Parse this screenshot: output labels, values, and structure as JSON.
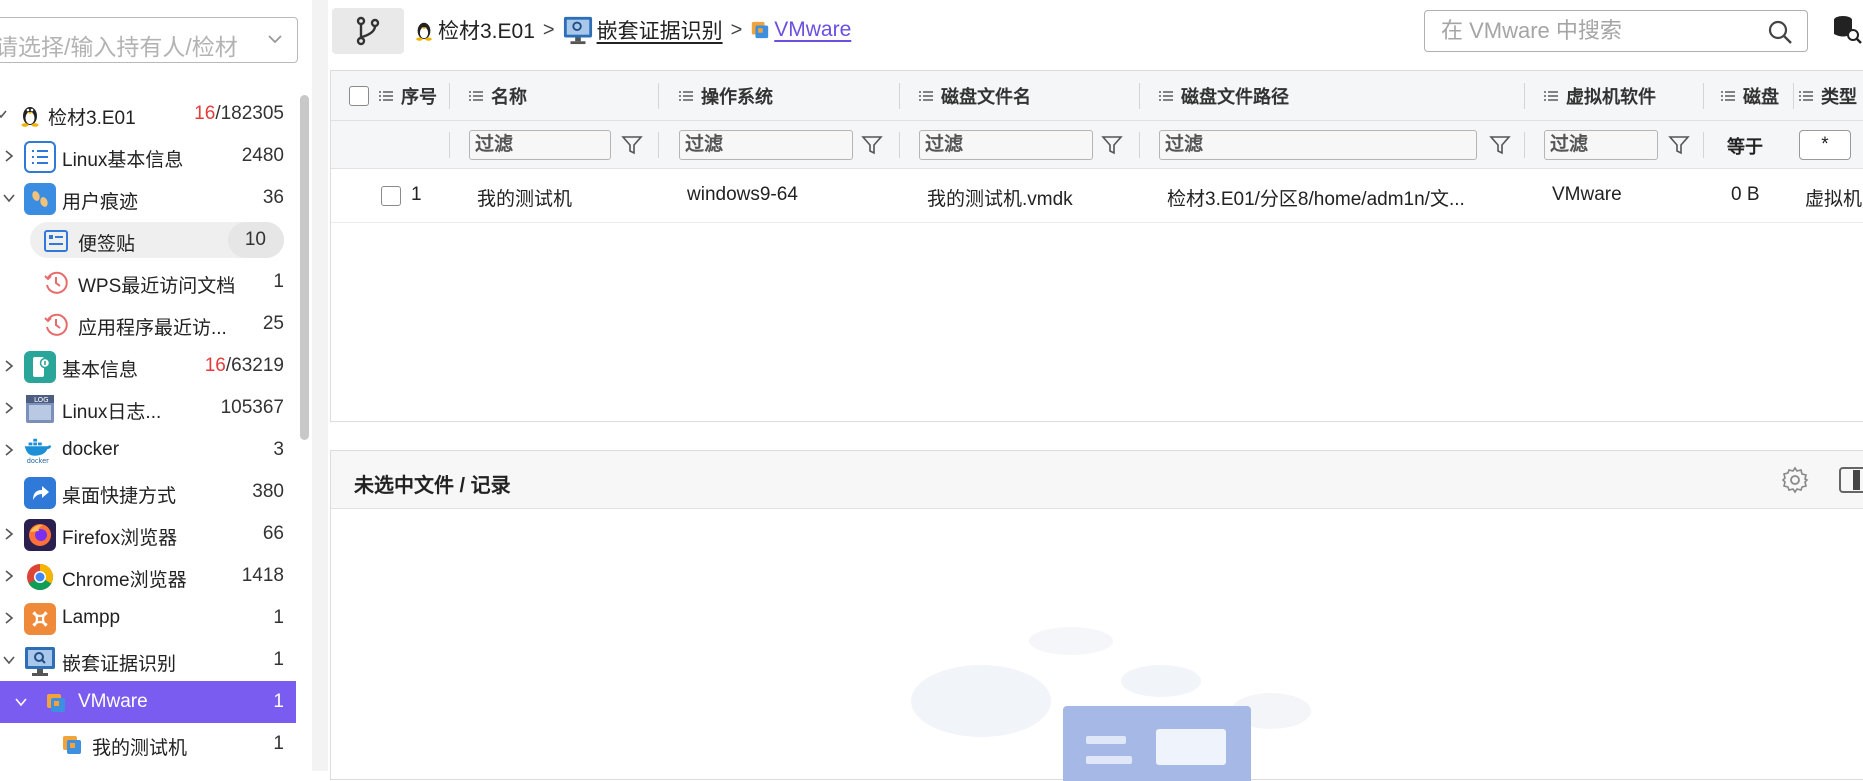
{
  "sidebar": {
    "holder_select_placeholder": "请选择/输入持有人/检材",
    "items": [
      {
        "label": "检材3.E01",
        "count_red": "16",
        "count_rest": "/182305"
      },
      {
        "label": "Linux基本信息",
        "count": "2480"
      },
      {
        "label": "用户痕迹",
        "count": "36"
      },
      {
        "label": "便签贴",
        "count": "10"
      },
      {
        "label": "WPS最近访问文档",
        "count": "1"
      },
      {
        "label": "应用程序最近访...",
        "count": "25"
      },
      {
        "label": "基本信息",
        "count_red": "16",
        "count_rest": "/63219"
      },
      {
        "label": "Linux日志...",
        "count": "105367"
      },
      {
        "label": "docker",
        "count": "3"
      },
      {
        "label": "桌面快捷方式",
        "count": "380"
      },
      {
        "label": "Firefox浏览器",
        "count": "66"
      },
      {
        "label": "Chrome浏览器",
        "count": "1418"
      },
      {
        "label": "Lampp",
        "count": "1"
      },
      {
        "label": "嵌套证据识别",
        "count": "1"
      },
      {
        "label": "VMware",
        "count": "1"
      },
      {
        "label": "我的测试机",
        "count": "1"
      }
    ]
  },
  "breadcrumb": {
    "items": [
      "检材3.E01",
      "嵌套证据识别",
      "VMware"
    ],
    "separator": ">"
  },
  "search": {
    "placeholder": "在 VMware 中搜索"
  },
  "table": {
    "columns": [
      "序号",
      "名称",
      "操作系统",
      "磁盘文件名",
      "磁盘文件路径",
      "虚拟机软件",
      "磁盘",
      "类型"
    ],
    "filter_placeholder": "过滤",
    "size_filter_op": "等于",
    "type_filter_value": "*",
    "rows": [
      {
        "index": "1",
        "name": "我的测试机",
        "os": "windows9-64",
        "disk_file": "我的测试机.vmdk",
        "disk_path": "检材3.E01/分区8/home/adm1n/文...",
        "software": "VMware",
        "size": "0 B",
        "type": "虚拟机"
      }
    ]
  },
  "detail": {
    "title": "未选中文件 / 记录"
  },
  "colors": {
    "accent": "#7a5cf0",
    "link": "#6d4fe0",
    "count_red": "#e63c3c"
  }
}
